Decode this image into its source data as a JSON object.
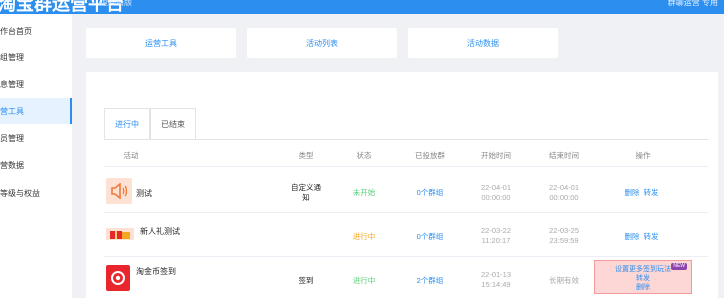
{
  "header": {
    "brand": "淘宝群运营平台",
    "subtitle": "返回旧版",
    "user": "群聊运营 专用"
  },
  "sidebar": {
    "items": [
      {
        "label": "作台首页"
      },
      {
        "label": "组管理"
      },
      {
        "label": "息管理"
      },
      {
        "label": "营工具",
        "active": true
      },
      {
        "label": "员管理"
      },
      {
        "label": "营数据"
      },
      {
        "label": "等级与权益"
      }
    ]
  },
  "quick_cards": [
    "运营工具",
    "活动列表",
    "活动数据"
  ],
  "tabs": [
    "进行中",
    "已结束"
  ],
  "table": {
    "headers": [
      "活动",
      "类型",
      "状态",
      "已投放群",
      "开始时间",
      "结束时间",
      "操作"
    ],
    "rows": [
      {
        "name": "测试",
        "type": "自定义通知",
        "status": "未开始",
        "groups": "0个群组",
        "start": "22-04-01 00:00:00",
        "end": "22-04-01 00:00:00",
        "actions": [
          "删除",
          "转发"
        ]
      },
      {
        "name": "新人礼测试",
        "type": "",
        "status": "进行中",
        "groups": "0个群组",
        "start": "22-03-22 11:20:17",
        "end": "22-03-25 23:59:59",
        "actions": [
          "删除",
          "转发"
        ]
      },
      {
        "name": "淘金币签到",
        "type": "签到",
        "status": "进行中",
        "groups": "2个群组",
        "start": "22-01-13 15:14:49",
        "end": "长期有效",
        "promo": "设置更多签到玩法",
        "promo_badge": "NEW",
        "actions": [
          "转发",
          "删除"
        ]
      }
    ]
  },
  "colors": {
    "accent": "#2c8ff0",
    "status_pending": "#5ad07b",
    "status_running": "#f5a623"
  }
}
